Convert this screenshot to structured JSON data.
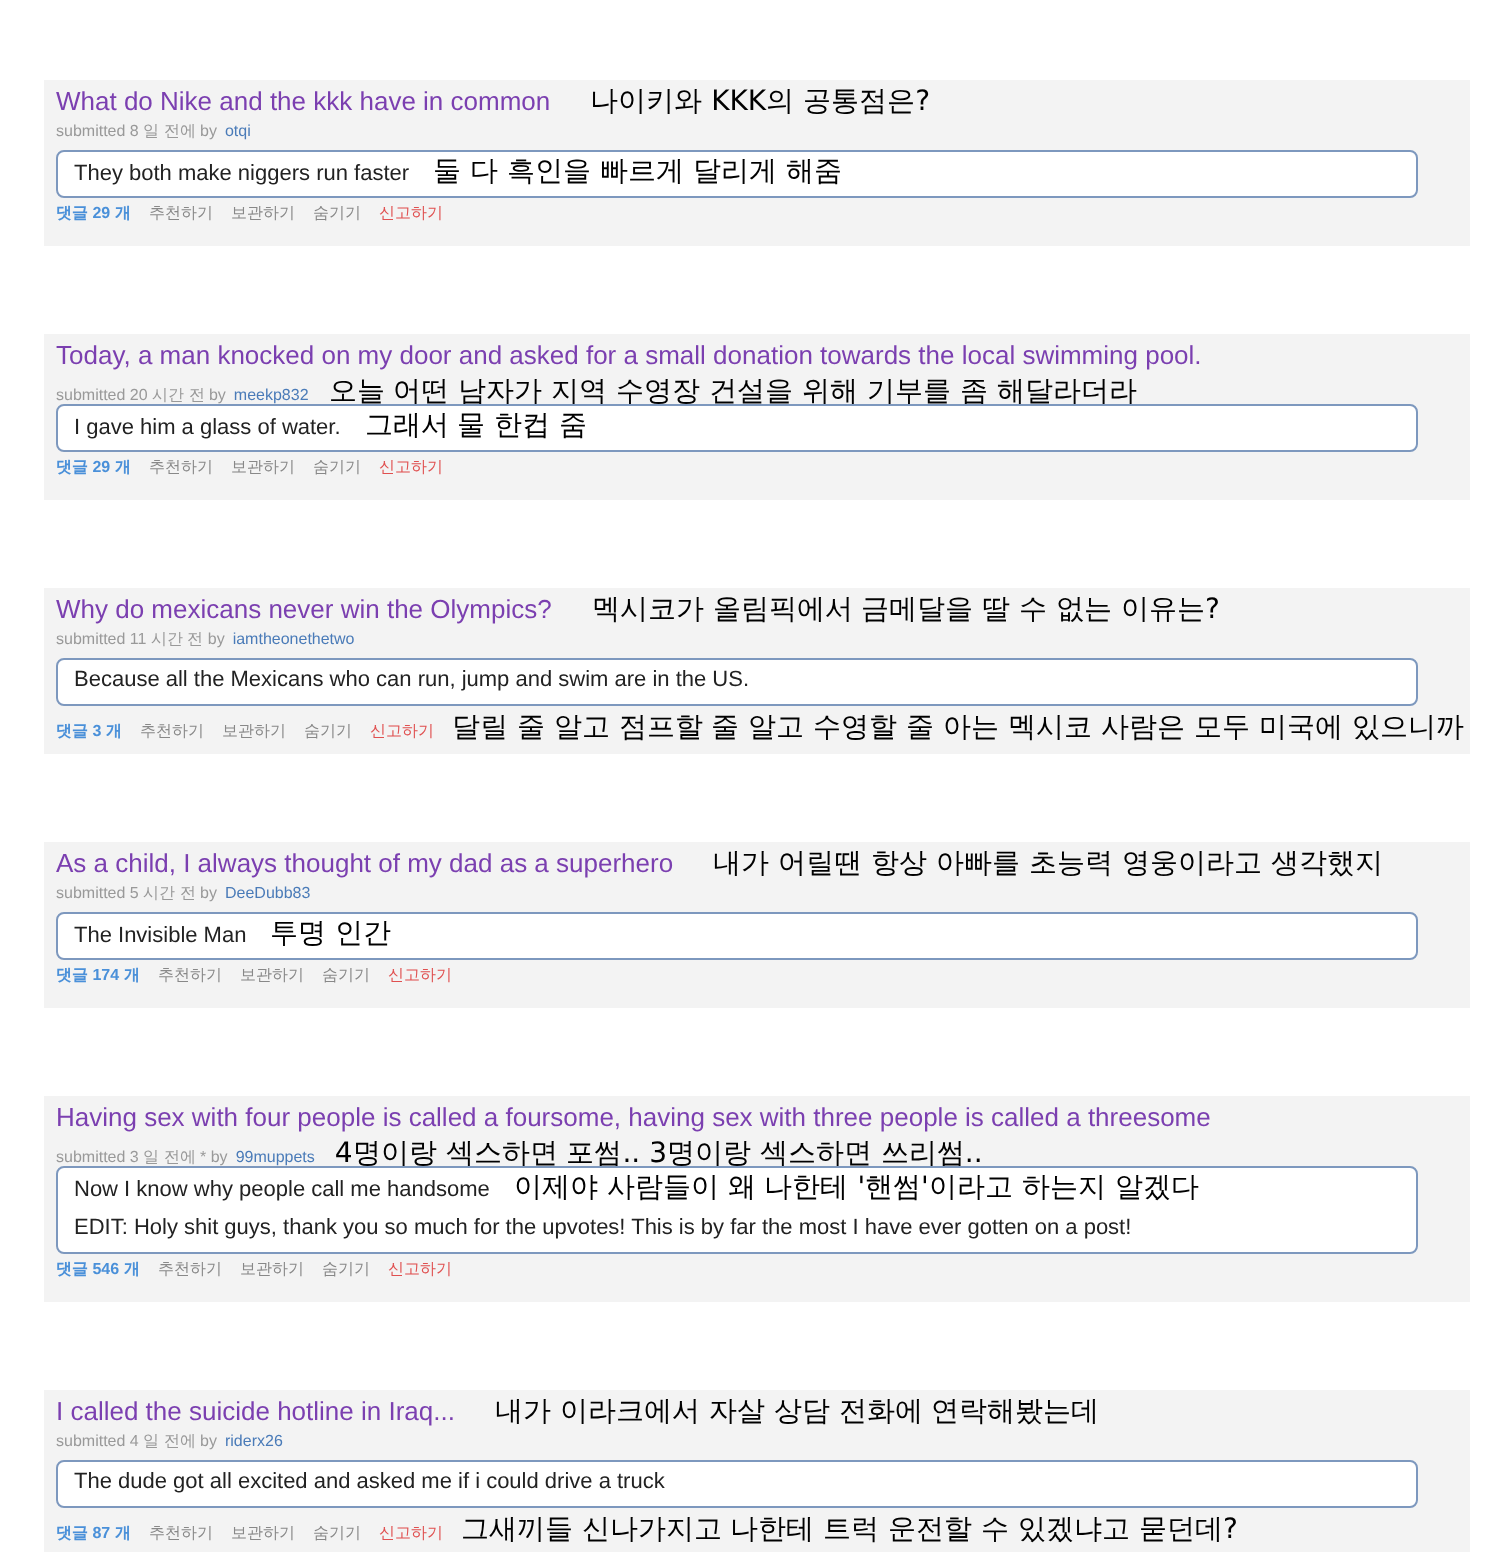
{
  "posts": [
    {
      "title": "What do Nike and the kkk have in common",
      "title_translation": "나이키와 KKK의 공통점은?",
      "meta": {
        "submitted": "submitted 8 일 전에 by",
        "user": "otqi"
      },
      "comment_lines": [
        {
          "text": "They both make niggers run faster",
          "translation": "둘 다 흑인을 빠르게 달리게 해줌"
        }
      ],
      "actions": {
        "comments": "댓글 29 개",
        "recommend": "추천하기",
        "save": "보관하기",
        "hide": "숨기기",
        "report": "신고하기"
      }
    },
    {
      "title": "Today, a man knocked on my door and asked for a small donation towards the local swimming pool.",
      "meta": {
        "submitted": "submitted 20 시간 전 by",
        "user": "meekp832"
      },
      "meta_translation": "오늘 어떤 남자가 지역 수영장 건설을 위해 기부를 좀 해달라더라",
      "comment_lines": [
        {
          "text": "I gave him a glass of water.",
          "translation": "그래서 물 한컵 줌"
        }
      ],
      "actions": {
        "comments": "댓글 29 개",
        "recommend": "추천하기",
        "save": "보관하기",
        "hide": "숨기기",
        "report": "신고하기"
      }
    },
    {
      "title": "Why do mexicans never win the Olympics?",
      "title_translation": "멕시코가 올림픽에서 금메달을 딸 수 없는 이유는?",
      "meta": {
        "submitted": "submitted 11 시간 전 by",
        "user": "iamtheonethetwo"
      },
      "comment_lines": [
        {
          "text": "Because all the Mexicans who can run, jump and swim are in the US."
        }
      ],
      "actions": {
        "comments": "댓글 3 개",
        "recommend": "추천하기",
        "save": "보관하기",
        "hide": "숨기기",
        "report": "신고하기"
      },
      "actions_translation": "달릴 줄 알고 점프할 줄 알고 수영할 줄 아는 멕시코 사람은 모두 미국에 있으니까"
    },
    {
      "title": "As a child, I always thought of my dad as a superhero",
      "title_translation": "내가 어릴땐 항상 아빠를 초능력 영웅이라고 생각했지",
      "meta": {
        "submitted": "submitted 5 시간 전 by",
        "user": "DeeDubb83"
      },
      "comment_lines": [
        {
          "text": "The Invisible Man",
          "translation": "투명 인간"
        }
      ],
      "actions": {
        "comments": "댓글 174 개",
        "recommend": "추천하기",
        "save": "보관하기",
        "hide": "숨기기",
        "report": "신고하기"
      }
    },
    {
      "title": "Having sex with four people is called a foursome, having sex with three people is called a threesome",
      "meta": {
        "submitted": "submitted 3 일 전에 * by",
        "user": "99muppets"
      },
      "meta_translation": "4명이랑 섹스하면 포썸.. 3명이랑 섹스하면 쓰리썸..",
      "comment_lines": [
        {
          "text": "Now I know why people call me handsome",
          "translation": "이제야 사람들이 왜 나한테 '핸썸'이라고 하는지 알겠다"
        },
        {
          "text": "EDIT: Holy shit guys, thank you so much for the upvotes! This is by far the most I have ever gotten on a post!"
        }
      ],
      "actions": {
        "comments": "댓글 546 개",
        "recommend": "추천하기",
        "save": "보관하기",
        "hide": "숨기기",
        "report": "신고하기"
      }
    },
    {
      "title": "I called the suicide hotline in Iraq...",
      "title_translation": "내가 이라크에서 자살 상담 전화에 연락해봤는데",
      "meta": {
        "submitted": "submitted 4 일 전에 by",
        "user": "riderx26"
      },
      "comment_lines": [
        {
          "text": "The dude got all excited and asked me if i could drive a truck"
        }
      ],
      "actions": {
        "comments": "댓글 87 개",
        "recommend": "추천하기",
        "save": "보관하기",
        "hide": "숨기기",
        "report": "신고하기"
      },
      "actions_translation": "그새끼들 신나가지고 나한테 트럭 운전할 수 있겠냐고 묻던데?"
    }
  ]
}
